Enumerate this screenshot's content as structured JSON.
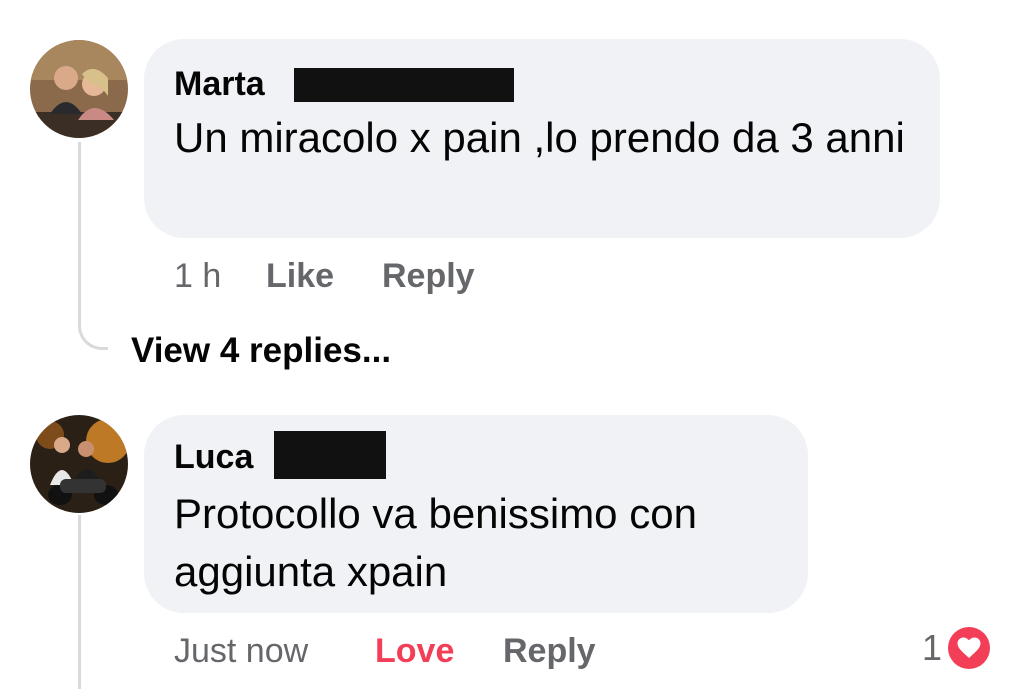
{
  "comments": [
    {
      "author": "Marta",
      "text": "Un miracolo x pain ,lo prendo da 3 anni",
      "time": "1 h",
      "like_label": "Like",
      "reply_label": "Reply"
    },
    {
      "author": "Luca",
      "text": "Protocollo va benissimo con aggiunta xpain",
      "time": "Just now",
      "like_label": "Love",
      "reply_label": "Reply",
      "reaction_count": "1",
      "reaction_icon": "heart-icon"
    }
  ],
  "thread": {
    "view_replies_label": "View 4 replies..."
  },
  "colors": {
    "bubble": "#f0f2f5",
    "meta_text": "#65676b",
    "love": "#f33e58",
    "thread_line": "#d9dadd"
  }
}
